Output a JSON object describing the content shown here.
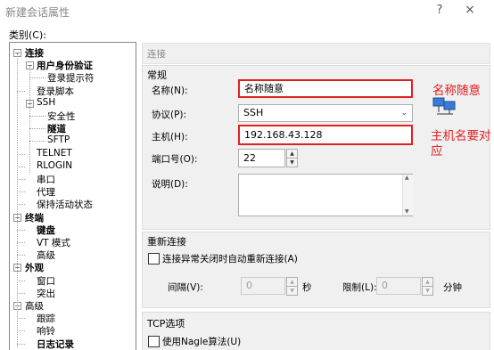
{
  "window": {
    "title": "新建会话属性",
    "help": "?",
    "close": "×"
  },
  "category_label": "类别(C):",
  "tree": [
    {
      "label": "连接",
      "bold": true,
      "level": 0,
      "expander": "−"
    },
    {
      "label": "用户身份验证",
      "bold": true,
      "level": 1,
      "expander": "−"
    },
    {
      "label": "登录提示符",
      "bold": false,
      "level": 2
    },
    {
      "label": "登录脚本",
      "bold": false,
      "level": 1
    },
    {
      "label": "SSH",
      "bold": false,
      "level": 1,
      "expander": "−"
    },
    {
      "label": "安全性",
      "bold": false,
      "level": 2
    },
    {
      "label": "隧道",
      "bold": true,
      "level": 2
    },
    {
      "label": "SFTP",
      "bold": false,
      "level": 2
    },
    {
      "label": "TELNET",
      "bold": false,
      "level": 1
    },
    {
      "label": "RLOGIN",
      "bold": false,
      "level": 1
    },
    {
      "label": "串口",
      "bold": false,
      "level": 1
    },
    {
      "label": "代理",
      "bold": false,
      "level": 1
    },
    {
      "label": "保持活动状态",
      "bold": false,
      "level": 1
    },
    {
      "label": "终端",
      "bold": true,
      "level": 0,
      "expander": "−"
    },
    {
      "label": "键盘",
      "bold": true,
      "level": 1
    },
    {
      "label": "VT 模式",
      "bold": false,
      "level": 1
    },
    {
      "label": "高级",
      "bold": false,
      "level": 1
    },
    {
      "label": "外观",
      "bold": true,
      "level": 0,
      "expander": "−"
    },
    {
      "label": "窗口",
      "bold": false,
      "level": 1
    },
    {
      "label": "突出",
      "bold": false,
      "level": 1
    },
    {
      "label": "高级",
      "bold": false,
      "level": 0,
      "expander": "−"
    },
    {
      "label": "跟踪",
      "bold": false,
      "level": 1
    },
    {
      "label": "响铃",
      "bold": false,
      "level": 1
    },
    {
      "label": "日志记录",
      "bold": true,
      "level": 1
    }
  ],
  "panel": {
    "header": "连接",
    "general": {
      "title": "常规",
      "name_label": "名称(N):",
      "name_value": "名称随意",
      "protocol_label": "协议(P):",
      "protocol_value": "SSH",
      "host_label": "主机(H):",
      "host_value": "192.168.43.128",
      "port_label": "端口号(O):",
      "port_value": "22",
      "desc_label": "说明(D):",
      "desc_value": ""
    },
    "reconnect": {
      "title": "重新连接",
      "checkbox_label": "连接异常关闭时自动重新连接(A)",
      "interval_label": "间隔(V):",
      "interval_value": "0",
      "interval_unit": "秒",
      "limit_label": "限制(L):",
      "limit_value": "0",
      "limit_unit": "分钟"
    },
    "tcp": {
      "title": "TCP选项",
      "nagle_label": "使用Nagle算法(U)"
    }
  },
  "annotations": {
    "name_note": "名称随意",
    "host_note_line1": "主机名要对",
    "host_note_line2": "应"
  },
  "colors": {
    "annotation": "#e02020",
    "window_bg": "#ffffff",
    "panel_bg": "#f0f0f0"
  }
}
